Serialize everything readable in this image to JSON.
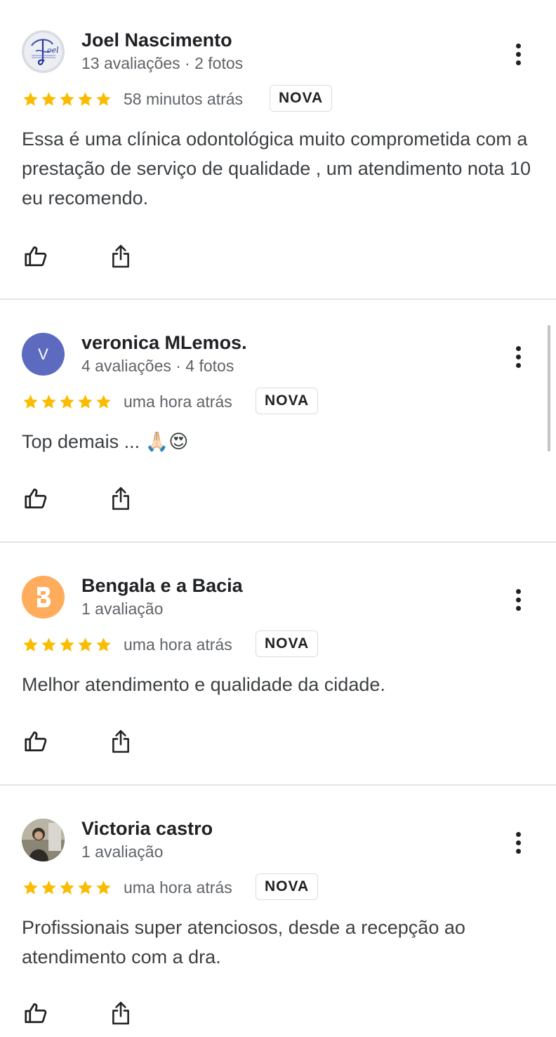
{
  "colors": {
    "star": "#f9bc00",
    "divider": "#e3e3e3",
    "avatar_letter_bg": "#5c6bc0",
    "avatar_orange_bg": "#ffad5c"
  },
  "reviews": [
    {
      "name": "Joel Nascimento",
      "meta": "13 avaliações · 2 fotos",
      "rating": 5,
      "time": "58 minutos atrás",
      "badge": "NOVA",
      "text": "Essa é uma clínica odontológica muito comprometida com a prestação de serviço de qualidade , um atendimento nota 10 eu recomendo.",
      "avatar_icon": "joel-logo-avatar"
    },
    {
      "name": "veronica MLemos.",
      "meta": "4 avaliações · 4 fotos",
      "rating": 5,
      "time": "uma hora atrás",
      "badge": "NOVA",
      "text": "Top demais ... 🙏🏻😍",
      "avatar_letter": "V"
    },
    {
      "name": "Bengala e a Bacia",
      "meta": "1 avaliação",
      "rating": 5,
      "time": "uma hora atrás",
      "badge": "NOVA",
      "text": "Melhor atendimento e qualidade da cidade.",
      "avatar_icon": "letter-b-avatar"
    },
    {
      "name": "Victoria castro",
      "meta": "1 avaliação",
      "rating": 5,
      "time": "uma hora atrás",
      "badge": "NOVA",
      "text": "Profissionais super atenciosos, desde a recepção ao atendimento com a dra.",
      "avatar_icon": "photo-avatar"
    }
  ],
  "icons": {
    "like": "thumbs-up-icon",
    "share": "share-icon",
    "more": "more-vert-icon",
    "star": "star-icon"
  }
}
